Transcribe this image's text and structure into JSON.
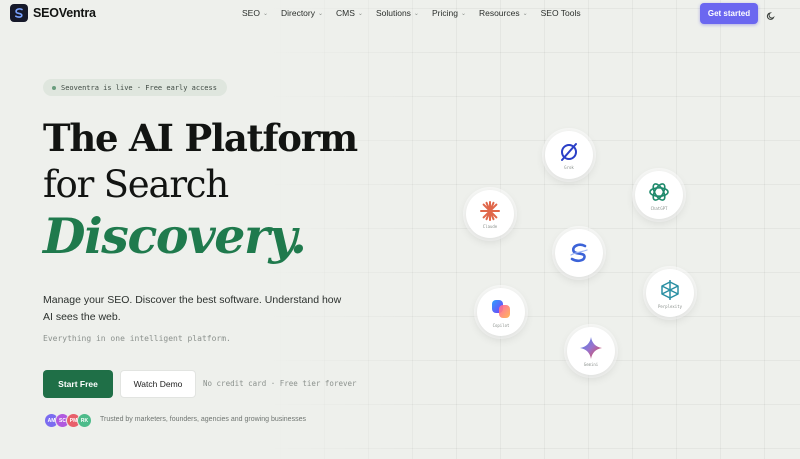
{
  "brand": {
    "name": "SEOVentra"
  },
  "nav": {
    "items": [
      {
        "label": "SEO",
        "dropdown": true
      },
      {
        "label": "Directory",
        "dropdown": true
      },
      {
        "label": "CMS",
        "dropdown": true
      },
      {
        "label": "Solutions",
        "dropdown": true
      },
      {
        "label": "Pricing",
        "dropdown": true
      },
      {
        "label": "Resources",
        "dropdown": true
      },
      {
        "label": "SEO Tools",
        "dropdown": false
      }
    ],
    "cta": "Get started",
    "theme_icon": "moon-icon"
  },
  "hero": {
    "badge": "Seoventra is live · Free early access",
    "title_line1": "The AI Platform",
    "title_line2": "for Search",
    "title_line3": "Discovery.",
    "description": "Manage your SEO. Discover the best software. Understand how AI sees the web.",
    "subtext": "Everything in one intelligent platform.",
    "primary_cta": "Start Free",
    "secondary_cta": "Watch Demo",
    "note": "No credit card · Free tier forever",
    "trusted": "Trusted by marketers, founders, agencies and growing businesses",
    "avatars": [
      {
        "initials": "AM",
        "color": "#7b6cf0"
      },
      {
        "initials": "SC",
        "color": "#b05adf"
      },
      {
        "initials": "PM",
        "color": "#e8606b"
      },
      {
        "initials": "RK",
        "color": "#4dbb8a"
      }
    ]
  },
  "ai_nodes": [
    {
      "name": "Grok",
      "label": "Grok",
      "icon": "grok-icon"
    },
    {
      "name": "ChatGPT",
      "label": "ChatGPT",
      "icon": "openai-icon"
    },
    {
      "name": "Claude",
      "label": "Claude",
      "icon": "claude-icon"
    },
    {
      "name": "SEOVentra",
      "label": "",
      "icon": "seoventra-icon"
    },
    {
      "name": "Perplexity",
      "label": "Perplexity",
      "icon": "perplexity-icon"
    },
    {
      "name": "Copilot",
      "label": "Copilot",
      "icon": "copilot-icon"
    },
    {
      "name": "Gemini",
      "label": "Gemini",
      "icon": "gemini-icon"
    }
  ],
  "colors": {
    "accent_green": "#1f7a4d",
    "cta_violet": "#6b67f0",
    "background": "#eef0ec"
  }
}
